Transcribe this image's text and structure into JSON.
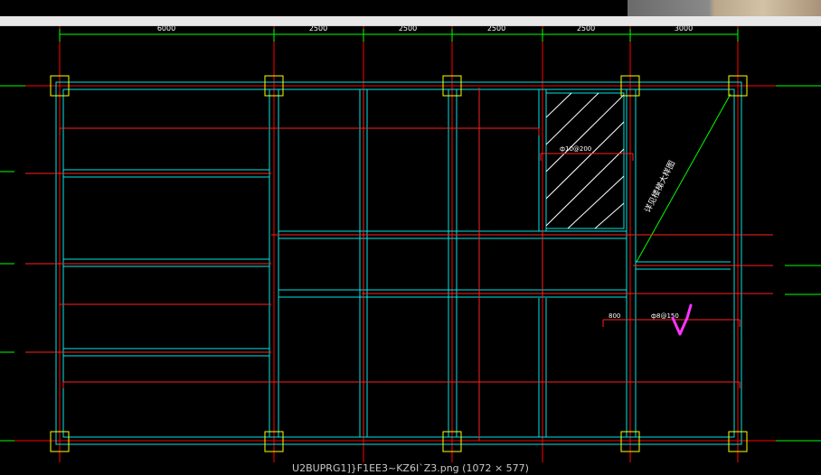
{
  "window": {
    "caption": "U2BUPRG1]}F1EE3~KZ6I`Z3.png (1072 × 577)"
  },
  "drawing": {
    "dimension_labels": [
      "6000",
      "2500",
      "2500",
      "2500",
      "2500",
      "3000"
    ],
    "rebar_note_1": "ф10@200",
    "rebar_note_2": "ф8@150",
    "span_note": "800",
    "rotated_note": "详见楼梯大样图",
    "colors": {
      "background": "#000000",
      "axis": "#ff0000",
      "beam_outline": "#00ffff",
      "slab_rebar": "#ff0000",
      "column": "#ffff00",
      "dimension": "#00ff00",
      "hatch": "#ffffff",
      "checkmark": "#ff00ff"
    }
  }
}
